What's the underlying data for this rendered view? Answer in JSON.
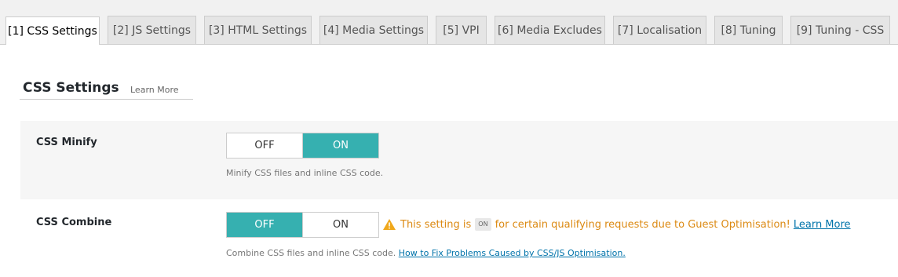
{
  "tabs": [
    {
      "label": "[1] CSS Settings"
    },
    {
      "label": "[2] JS Settings"
    },
    {
      "label": "[3] HTML Settings"
    },
    {
      "label": "[4] Media Settings"
    },
    {
      "label": "[5] VPI"
    },
    {
      "label": "[6] Media Excludes"
    },
    {
      "label": "[7] Localisation"
    },
    {
      "label": "[8] Tuning"
    },
    {
      "label": "[9] Tuning - CSS"
    }
  ],
  "active_tab": "[1] CSS Settings",
  "section": {
    "title": "CSS Settings",
    "learn_more": "Learn More"
  },
  "settings": [
    {
      "label": "CSS Minify",
      "off_label": "OFF",
      "on_label": "ON",
      "value": "ON",
      "description": "Minify CSS files and inline CSS code."
    },
    {
      "label": "CSS Combine",
      "off_label": "OFF",
      "on_label": "ON",
      "value": "OFF",
      "description": "Combine CSS files and inline CSS code.",
      "description_link": "How to Fix Problems Caused by CSS/JS Optimisation.",
      "warning": {
        "icon": "warning-icon",
        "text_before": "This setting is",
        "badge": "ON",
        "text_after": "for certain qualifying requests due to Guest Optimisation!",
        "link": "Learn More"
      }
    }
  ],
  "colors": {
    "accent": "#36b0b0",
    "warning": "#dc8a13",
    "link": "#0073aa"
  }
}
